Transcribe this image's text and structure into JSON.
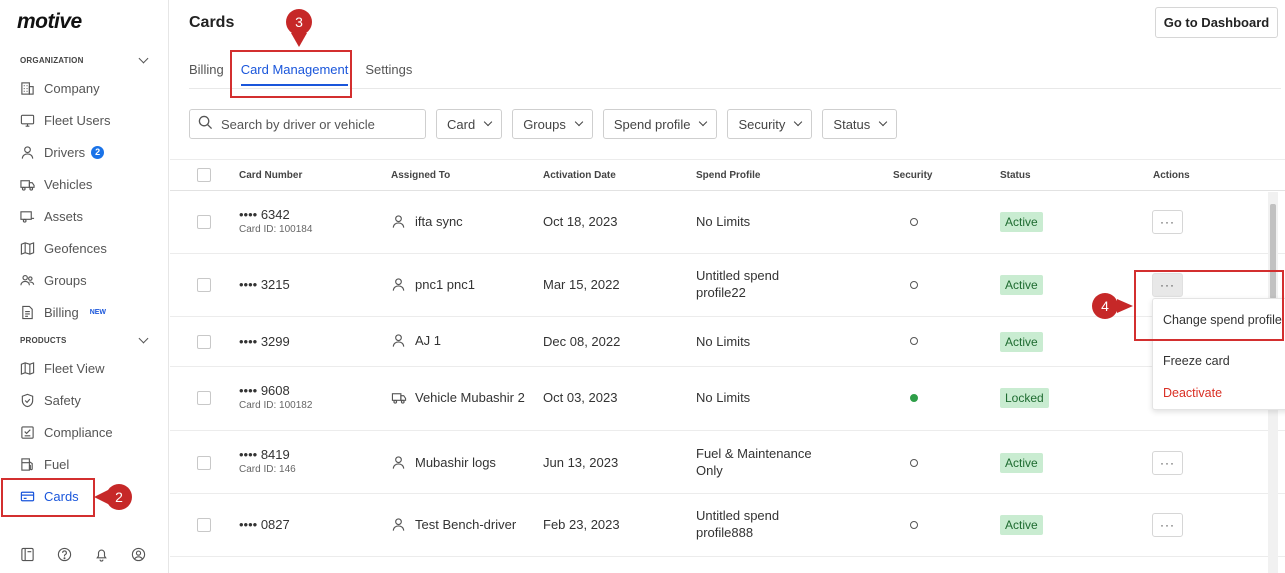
{
  "sidebar": {
    "logo": "motive",
    "organization_header": "ORGANIZATION",
    "products_header": "PRODUCTS",
    "org_items": [
      {
        "label": "Company",
        "icon": "building-icon"
      },
      {
        "label": "Fleet Users",
        "icon": "monitor-icon"
      },
      {
        "label": "Drivers",
        "icon": "person-icon",
        "badge": "2"
      },
      {
        "label": "Vehicles",
        "icon": "truck-icon"
      },
      {
        "label": "Assets",
        "icon": "trailer-icon"
      },
      {
        "label": "Geofences",
        "icon": "map-icon"
      },
      {
        "label": "Groups",
        "icon": "users-icon"
      },
      {
        "label": "Billing",
        "icon": "document-icon",
        "badge": "NEW"
      }
    ],
    "product_items": [
      {
        "label": "Fleet View",
        "icon": "map-icon"
      },
      {
        "label": "Safety",
        "icon": "shield-icon"
      },
      {
        "label": "Compliance",
        "icon": "checklist-icon"
      },
      {
        "label": "Fuel",
        "icon": "fuel-icon"
      },
      {
        "label": "Cards",
        "icon": "card-icon",
        "active": true
      }
    ],
    "bottom_icons": [
      "book-icon",
      "help-icon",
      "bell-icon",
      "account-icon"
    ]
  },
  "annotations": [
    "2",
    "3",
    "4"
  ],
  "header": {
    "title": "Cards",
    "dashboard_button": "Go to Dashboard"
  },
  "tabs": [
    "Billing",
    "Card Management",
    "Settings"
  ],
  "active_tab": "Card Management",
  "filters": {
    "search_placeholder": "Search by driver or vehicle",
    "dropdowns": [
      "Card",
      "Groups",
      "Spend profile",
      "Security",
      "Status"
    ]
  },
  "table": {
    "columns": [
      "Card Number",
      "Assigned To",
      "Activation Date",
      "Spend Profile",
      "Security",
      "Status",
      "Actions"
    ],
    "rows": [
      {
        "card": "•••• 6342",
        "card_id": "Card ID: 100184",
        "assigned": "ifta sync",
        "assigned_type": "person",
        "date": "Oct 18, 2023",
        "profile": "No Limits",
        "profile2": "",
        "security": "unlocked",
        "status": "Active"
      },
      {
        "card": "•••• 3215",
        "card_id": "",
        "assigned": "pnc1 pnc1",
        "assigned_type": "person",
        "date": "Mar 15, 2022",
        "profile": "Untitled spend",
        "profile2": "profile22",
        "security": "unlocked",
        "status": "Active"
      },
      {
        "card": "•••• 3299",
        "card_id": "",
        "assigned": "AJ 1",
        "assigned_type": "person",
        "date": "Dec 08, 2022",
        "profile": "No Limits",
        "profile2": "",
        "security": "unlocked",
        "status": "Active"
      },
      {
        "card": "•••• 9608",
        "card_id": "Card ID: 100182",
        "assigned": "Vehicle Mubashir 2",
        "assigned_type": "vehicle",
        "date": "Oct 03, 2023",
        "profile": "No Limits",
        "profile2": "",
        "security": "locked",
        "status": "Locked"
      },
      {
        "card": "•••• 8419",
        "card_id": "Card ID: 146",
        "assigned": "Mubashir logs",
        "assigned_type": "person",
        "date": "Jun 13, 2023",
        "profile": "Fuel & Maintenance",
        "profile2": "Only",
        "security": "unlocked",
        "status": "Active"
      },
      {
        "card": "•••• 0827",
        "card_id": "",
        "assigned": "Test Bench-driver",
        "assigned_type": "person",
        "date": "Feb 23, 2023",
        "profile": "Untitled spend",
        "profile2": "profile888",
        "security": "unlocked",
        "status": "Active"
      }
    ],
    "actions_glyph": "···"
  },
  "action_menu": {
    "items": [
      "Change spend profile",
      "Freeze card",
      "Deactivate"
    ]
  },
  "colors": {
    "accent": "#1a56db",
    "annotation": "#c62828",
    "active_status_bg": "#c9ecd1",
    "danger": "#d93025",
    "locked_dot": "#2e9e48"
  }
}
